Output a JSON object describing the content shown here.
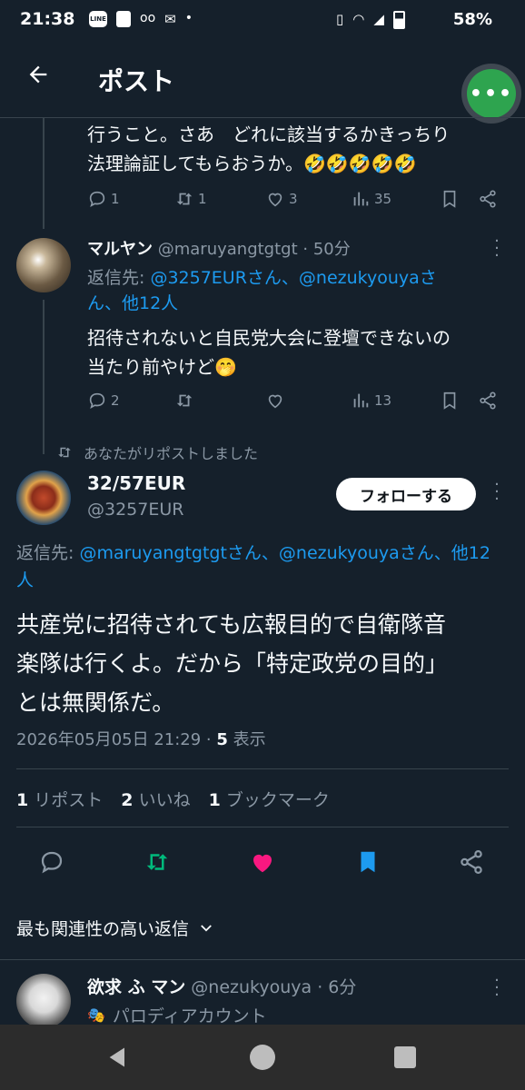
{
  "status_bar": {
    "time": "21:38",
    "battery": "58%"
  },
  "header": {
    "title": "ポスト",
    "back_icon": "arrow-left-icon",
    "more_icon": "more-dots-icon"
  },
  "prev_tweet": {
    "lines": [
      "行うこと。さあ　どれに該当するかきっちり",
      "法理論証してもらおうか。🤣🤣🤣🤣🤣"
    ],
    "actions": {
      "replies": "1",
      "reposts": "1",
      "likes": "3",
      "views": "35"
    }
  },
  "reply_tweet": {
    "name": "マルヤン",
    "handle": "@maruyangtgtgt",
    "time": "· 50分",
    "replying_label": "返信先:",
    "replying_line1_links": "@3257EURさん、@nezukyouyaさ",
    "replying_line2_links": "ん、他12人",
    "text_line1": "招待されないと自民党大会に登壇できないの",
    "text_line2": "当たり前やけど🤭",
    "actions": {
      "replies": "2",
      "reposts": "",
      "likes": "",
      "views": "13"
    }
  },
  "main_tweet": {
    "repost_notice": "あなたがリポストしました",
    "name": "32/57EUR",
    "handle": "@3257EUR",
    "follow_label": "フォローする",
    "replying_label": "返信先:",
    "replying_links_line1": "@maruyangtgtgtさん、@nezukyouyaさん、他12",
    "replying_links_line2": "人",
    "text_line1": "共産党に招待されても広報目的で自衛隊音",
    "text_line2": "楽隊は行くよ。だから「特定政党の目的」",
    "text_line3": "とは無関係だ。",
    "date": "2026年05月05日 21:29 ·",
    "views_count": "5",
    "views_label": "表示",
    "stats": {
      "reposts_count": "1",
      "reposts_label": "リポスト",
      "likes_count": "2",
      "likes_label": "いいね",
      "bookmarks_count": "1",
      "bookmarks_label": "ブックマーク"
    },
    "colors": {
      "repost_active": "#00ba7c",
      "like_active": "#f91880",
      "bookmark_active": "#1d9bf0"
    }
  },
  "replies_sort": {
    "label": "最も関連性の高い返信"
  },
  "next_reply": {
    "name": "欲求 ふ マン",
    "handle": "@nezukyouya",
    "time": "· 6分",
    "badge": "パロディアカウント"
  }
}
